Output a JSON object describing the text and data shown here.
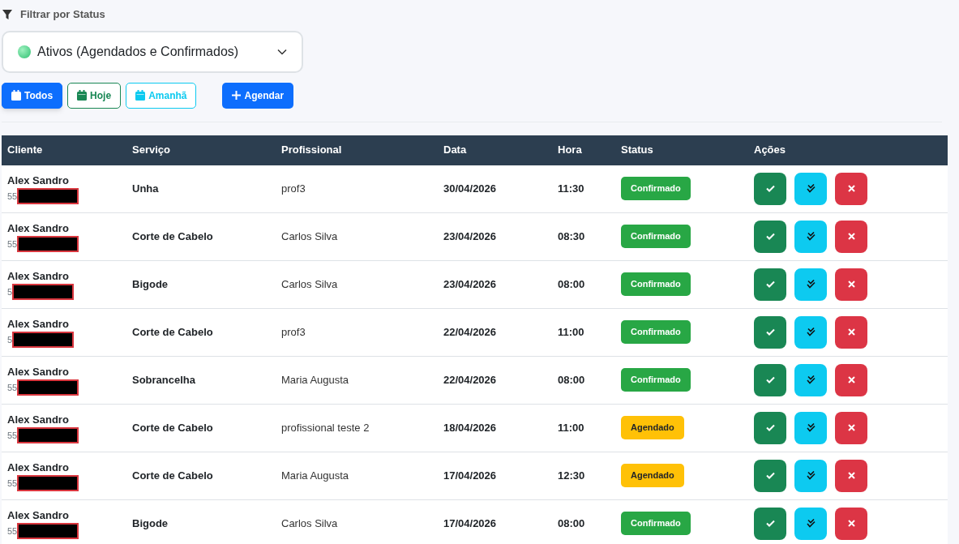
{
  "filter": {
    "label": "Filtrar por Status",
    "select_value": "Ativos (Agendados e Confirmados)"
  },
  "quick_filters": [
    {
      "label": "Todos",
      "kind": "all",
      "selected": true
    },
    {
      "label": "Hoje",
      "kind": "today",
      "selected": false
    },
    {
      "label": "Amanhã",
      "kind": "tomorrow",
      "selected": false
    }
  ],
  "new_button": "Agendar",
  "table": {
    "columns": [
      "Cliente",
      "Serviço",
      "Profissional",
      "Data",
      "Hora",
      "Status",
      "Ações"
    ],
    "rows": [
      {
        "client": "Alex Sandro",
        "phone": "55",
        "service": "Unha",
        "professional": "prof3",
        "date": "30/04/2026",
        "time": "11:30",
        "status": "Confirmado",
        "kind": "confirmed"
      },
      {
        "client": "Alex Sandro",
        "phone": "55",
        "service": "Corte de Cabelo",
        "professional": "Carlos Silva",
        "date": "23/04/2026",
        "time": "08:30",
        "status": "Confirmado",
        "kind": "confirmed"
      },
      {
        "client": "Alex Sandro",
        "phone": "5",
        "service": "Bigode",
        "professional": "Carlos Silva",
        "date": "23/04/2026",
        "time": "08:00",
        "status": "Confirmado",
        "kind": "confirmed"
      },
      {
        "client": "Alex Sandro",
        "phone": "5",
        "service": "Corte de Cabelo",
        "professional": "prof3",
        "date": "22/04/2026",
        "time": "11:00",
        "status": "Confirmado",
        "kind": "confirmed"
      },
      {
        "client": "Alex Sandro",
        "phone": "55",
        "service": "Sobrancelha",
        "professional": "Maria Augusta",
        "date": "22/04/2026",
        "time": "08:00",
        "status": "Confirmado",
        "kind": "confirmed"
      },
      {
        "client": "Alex Sandro",
        "phone": "55",
        "service": "Corte de Cabelo",
        "professional": "profissional teste 2",
        "date": "18/04/2026",
        "time": "11:00",
        "status": "Agendado",
        "kind": "scheduled"
      },
      {
        "client": "Alex Sandro",
        "phone": "55",
        "service": "Corte de Cabelo",
        "professional": "Maria Augusta",
        "date": "17/04/2026",
        "time": "12:30",
        "status": "Agendado",
        "kind": "scheduled"
      },
      {
        "client": "Alex Sandro",
        "phone": "55",
        "service": "Bigode",
        "professional": "Carlos Silva",
        "date": "17/04/2026",
        "time": "08:00",
        "status": "Confirmado",
        "kind": "confirmed"
      }
    ]
  }
}
